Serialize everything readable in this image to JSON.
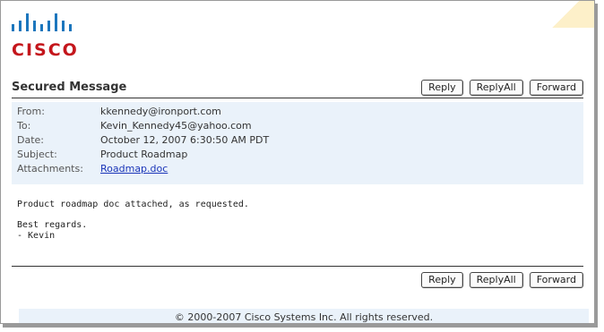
{
  "logo": {
    "name": "cisco-logo",
    "text": "CISCO",
    "color": "#c4161c"
  },
  "title": "Secured Message",
  "buttons": {
    "reply": "Reply",
    "reply_all": "ReplyAll",
    "forward": "Forward"
  },
  "headers": [
    {
      "label": "From:",
      "value": "kkennedy@ironport.com"
    },
    {
      "label": "To:",
      "value": "Kevin_Kennedy45@yahoo.com"
    },
    {
      "label": "Date:",
      "value": "October 12, 2007 6:30:50 AM PDT"
    },
    {
      "label": "Subject:",
      "value": "Product Roadmap"
    },
    {
      "label": "Attachments:",
      "value": "Roadmap.doc"
    }
  ],
  "body": {
    "line1": "Product roadmap doc attached, as requested.",
    "line2": "Best regards.",
    "line3": "- Kevin"
  },
  "footer": "© 2000-2007 Cisco Systems Inc. All rights reserved."
}
